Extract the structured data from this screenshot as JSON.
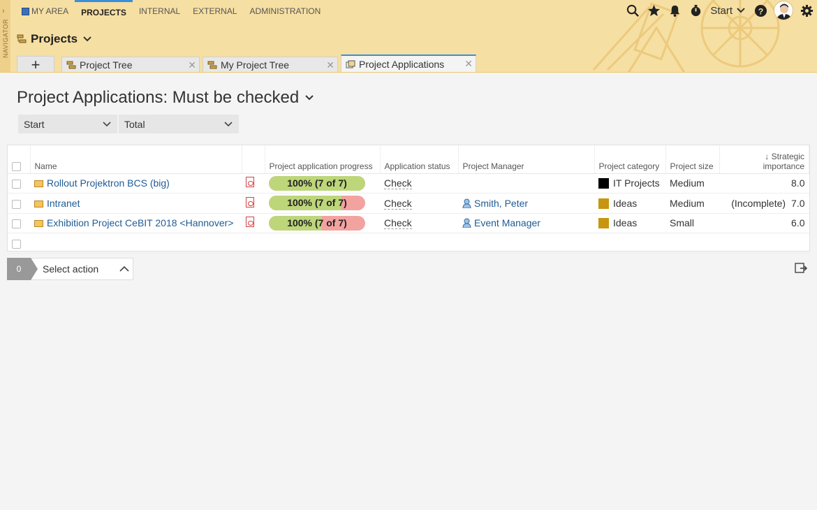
{
  "navigator": {
    "label": "NAVIGATOR"
  },
  "mainnav": {
    "items": [
      "MY AREA",
      "PROJECTS",
      "INTERNAL",
      "EXTERNAL",
      "ADMINISTRATION"
    ]
  },
  "topbar": {
    "start_label": "Start"
  },
  "module": {
    "title": "Projects"
  },
  "tabs": [
    {
      "label": "Project Tree"
    },
    {
      "label": "My Project Tree"
    },
    {
      "label": "Project Applications"
    }
  ],
  "page": {
    "title": "Project Applications: Must be checked"
  },
  "filters": {
    "start": "Start",
    "total": "Total"
  },
  "table": {
    "headers": {
      "name": "Name",
      "progress": "Project application progress",
      "status": "Application status",
      "manager": "Project Manager",
      "category": "Project category",
      "size": "Project size",
      "importance_1": "Strategic",
      "importance_2": "importance"
    },
    "rows": [
      {
        "name": "Rollout Projektron BCS (big)",
        "progress_text": "100% (7 of 7)",
        "progress": 1.0,
        "status": "Check",
        "manager": "",
        "category": "IT Projects",
        "category_color": "#000000",
        "size": "Medium",
        "note": "",
        "importance": "8.0"
      },
      {
        "name": "Intranet",
        "progress_text": "100% (7 of 7)",
        "progress": 0.75,
        "status": "Check",
        "manager": "Smith, Peter",
        "category": "Ideas",
        "category_color": "#c8950e",
        "size": "Medium",
        "note": "(Incomplete)",
        "importance": "7.0"
      },
      {
        "name": "Exhibition Project CeBIT 2018 <Hannover>",
        "progress_text": "100% (7 of 7)",
        "progress": 0.55,
        "status": "Check",
        "manager": "Event Manager",
        "category": "Ideas",
        "category_color": "#c8950e",
        "size": "Small",
        "note": "",
        "importance": "6.0"
      }
    ]
  },
  "actionbar": {
    "count": "0",
    "select_label": "Select action"
  },
  "colors": {
    "progress_ok": "#bdd67a",
    "progress_warn": "#f2a3a0",
    "accent": "#3a8fd8",
    "header_bg": "#f6dfa2"
  }
}
